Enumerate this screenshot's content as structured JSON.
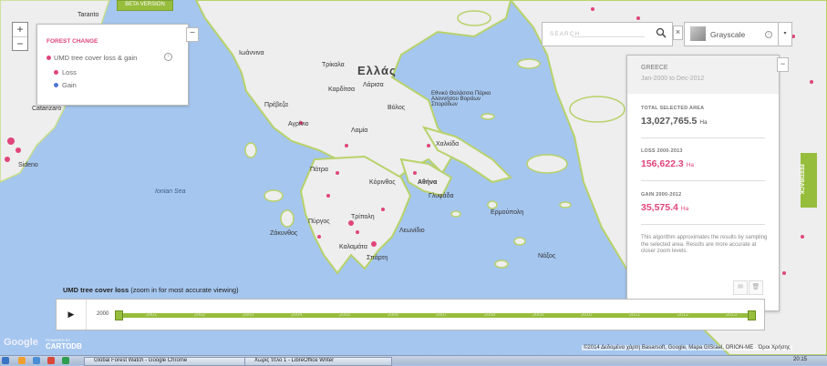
{
  "beta_badge": "BETA VERSION",
  "zoom": {
    "in": "+",
    "out": "−"
  },
  "legend": {
    "title": "FOREST CHANGE",
    "layer": "UMD tree cover loss & gain",
    "info": "i",
    "items": [
      {
        "label": "Loss",
        "color": "#e0457b"
      },
      {
        "label": "Gain",
        "color": "#4d74d6"
      }
    ],
    "collapse": "−"
  },
  "search": {
    "placeholder": "SEARCH",
    "close": "×"
  },
  "basemap": {
    "label": "Grayscale",
    "info": "i",
    "caret": "▾"
  },
  "analysis": {
    "region": "GREECE",
    "period": "Jan-2000 to Dec-2012",
    "total_label": "TOTAL SELECTED AREA",
    "total_value": "13,027,765.5",
    "total_unit": "Ha",
    "loss_label": "LOSS 2000-2013",
    "loss_value": "156,622.3",
    "loss_unit": "Ha",
    "gain_label": "GAIN 2000-2012",
    "gain_value": "35,575.4",
    "gain_unit": "Ha",
    "note": "This algorithm approximates the results by sampling the selected area. Results are more accurate at closer zoom levels.",
    "collapse": "−"
  },
  "feedback": "FEEDBACK",
  "timeline": {
    "title_bold": "UMD tree cover loss",
    "title_rest": " (zoom in for most accurate viewing)",
    "play": "▶",
    "start_year": "2000",
    "years": [
      "2001",
      "2002",
      "2003",
      "2004",
      "2005",
      "2006",
      "2007",
      "2008",
      "2009",
      "2010",
      "2011",
      "2012",
      "2013"
    ]
  },
  "map_labels": {
    "country": "Ελλάς",
    "sea": "Ionian Sea",
    "places": [
      "Taranto",
      "Catanzaro",
      "Sideno",
      "Πρέβεζα",
      "Λάρισα",
      "Βόλος",
      "Λαμία",
      "Πάτρα",
      "Κόρινθος",
      "Αθήνα",
      "Γλυφάδα",
      "Καλαμάτα",
      "Τρίπολη",
      "Σπάρτη",
      "Ερμούπολη",
      "Νάξος",
      "Χαλκίδα",
      "Τρίκαλα",
      "Καρδίτσα",
      "Αγρίνιο",
      "Ιωάννινα",
      "Ζάκυνθος",
      "Πύργος",
      "Λεωνίδιο"
    ],
    "marine_park": "Εθνικό Θαλάσσιο Πάρκο Αλοννήσου Βορείων Σποράδων"
  },
  "branding": {
    "google": "Google",
    "carto_top": "POWERED BY",
    "carto": "CARTODB"
  },
  "attribution": "©2014 Δεδομένα χάρτη Basarsoft, Google, Mapa GISrael, ORION-ME · Όροι Χρήσης",
  "taskbar": {
    "tasks": [
      "Global Forest Watch - Google Chrome",
      "Χωρίς τίτλο 1 - LibreOffice Writer"
    ],
    "clock": "20:15"
  },
  "colors": {
    "accent_green": "#97bd3d",
    "loss_pink": "#e0457b",
    "gain_blue": "#4d74d6",
    "sea": "#a5c6ee",
    "land": "#efefef"
  }
}
